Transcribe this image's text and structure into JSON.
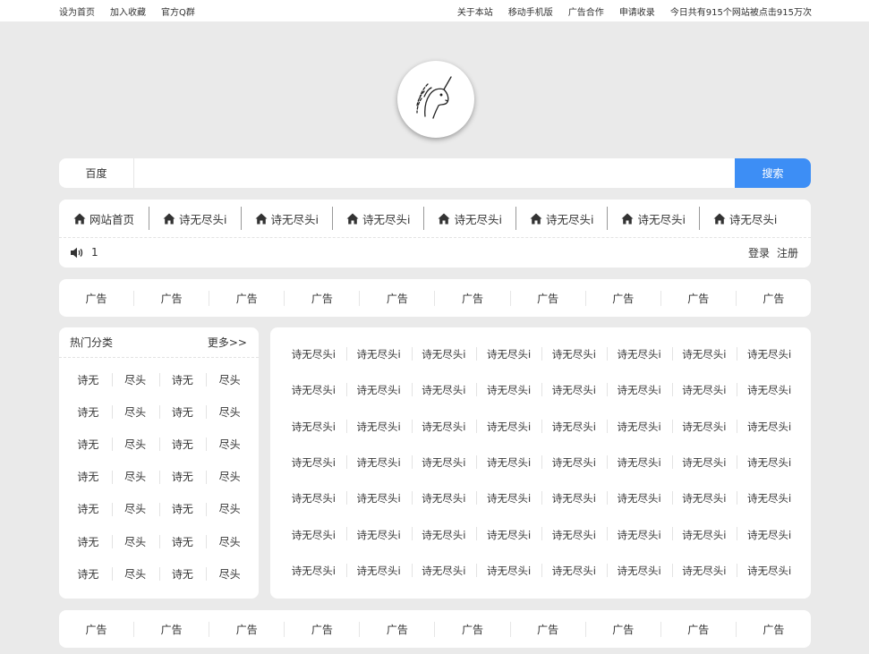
{
  "topbar": {
    "left": [
      "设为首页",
      "加入收藏",
      "官方Q群"
    ],
    "right": [
      "关于本站",
      "移动手机版",
      "广告合作",
      "申请收录",
      "今日共有915个网站被点击915万次"
    ]
  },
  "search": {
    "engine": "百度",
    "placeholder": "",
    "button": "搜索"
  },
  "nav": {
    "items": [
      "网站首页",
      "诗无尽头i",
      "诗无尽头i",
      "诗无尽头i",
      "诗无尽头i",
      "诗无尽头i",
      "诗无尽头i",
      "诗无尽头i"
    ],
    "notice": "1",
    "login": "登录",
    "register": "注册"
  },
  "ads_top": [
    "广告",
    "广告",
    "广告",
    "广告",
    "广告",
    "广告",
    "广告",
    "广告",
    "广告",
    "广告"
  ],
  "ads_bottom": [
    "广告",
    "广告",
    "广告",
    "广告",
    "广告",
    "广告",
    "广告",
    "广告",
    "广告",
    "广告"
  ],
  "hot": {
    "title": "热门分类",
    "more": "更多>>",
    "items": [
      "诗无",
      "尽头",
      "诗无",
      "尽头",
      "诗无",
      "尽头",
      "诗无",
      "尽头",
      "诗无",
      "尽头",
      "诗无",
      "尽头",
      "诗无",
      "尽头",
      "诗无",
      "尽头",
      "诗无",
      "尽头",
      "诗无",
      "尽头",
      "诗无",
      "尽头",
      "诗无",
      "尽头",
      "诗无",
      "尽头",
      "诗无",
      "尽头"
    ]
  },
  "links": [
    "诗无尽头i",
    "诗无尽头i",
    "诗无尽头i",
    "诗无尽头i",
    "诗无尽头i",
    "诗无尽头i",
    "诗无尽头i",
    "诗无尽头i",
    "诗无尽头i",
    "诗无尽头i",
    "诗无尽头i",
    "诗无尽头i",
    "诗无尽头i",
    "诗无尽头i",
    "诗无尽头i",
    "诗无尽头i",
    "诗无尽头i",
    "诗无尽头i",
    "诗无尽头i",
    "诗无尽头i",
    "诗无尽头i",
    "诗无尽头i",
    "诗无尽头i",
    "诗无尽头i",
    "诗无尽头i",
    "诗无尽头i",
    "诗无尽头i",
    "诗无尽头i",
    "诗无尽头i",
    "诗无尽头i",
    "诗无尽头i",
    "诗无尽头i",
    "诗无尽头i",
    "诗无尽头i",
    "诗无尽头i",
    "诗无尽头i",
    "诗无尽头i",
    "诗无尽头i",
    "诗无尽头i",
    "诗无尽头i",
    "诗无尽头i",
    "诗无尽头i",
    "诗无尽头i",
    "诗无尽头i",
    "诗无尽头i",
    "诗无尽头i",
    "诗无尽头i",
    "诗无尽头i",
    "诗无尽头i",
    "诗无尽头i",
    "诗无尽头i",
    "诗无尽头i",
    "诗无尽头i",
    "诗无尽头i",
    "诗无尽头i",
    "诗无尽头i"
  ],
  "colors": {
    "accent": "#3d8ef5",
    "background": "#eaeaea"
  },
  "icons": {
    "nav": "home-icon",
    "notice": "speaker-icon",
    "logo": "unicorn-logo"
  }
}
